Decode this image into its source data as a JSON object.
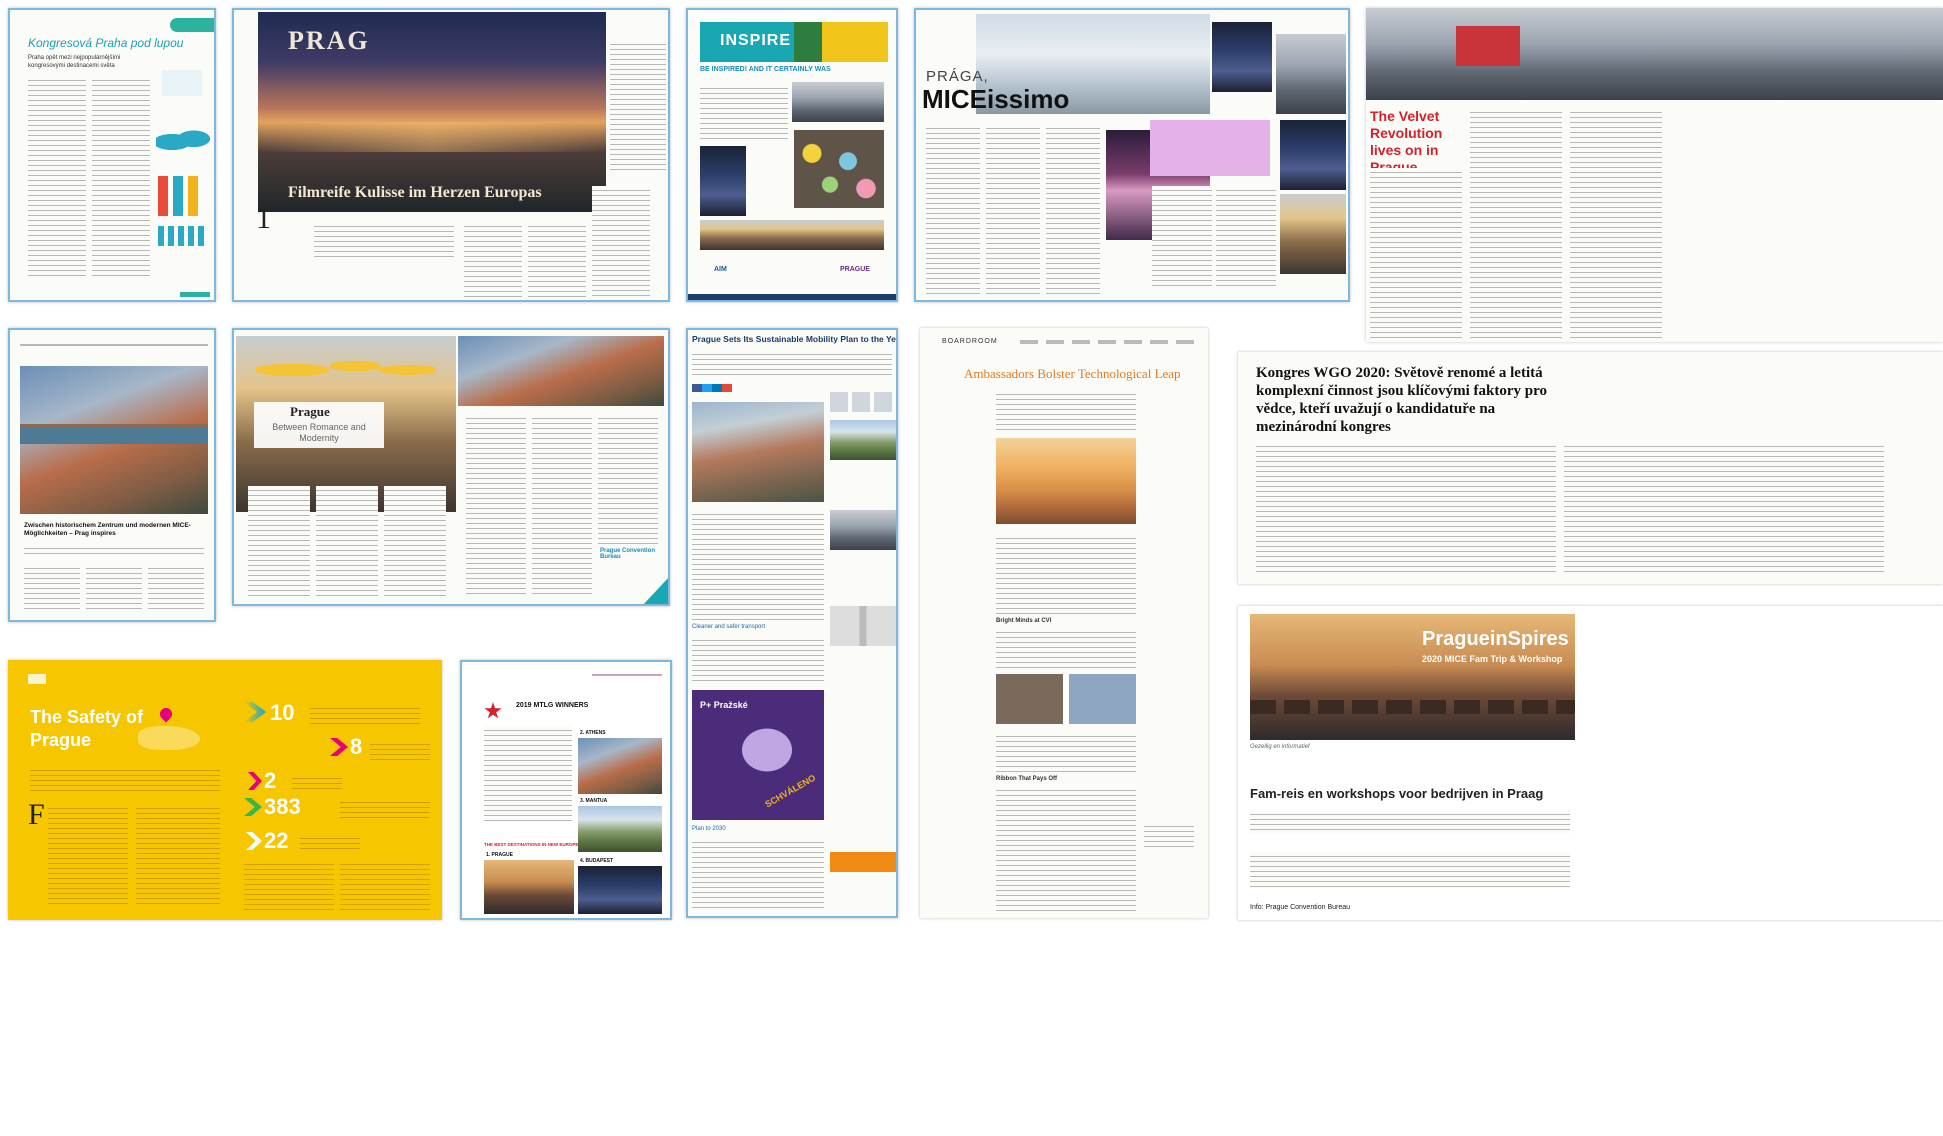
{
  "colors": {
    "frame_blue": "#7fb8de",
    "cover_teal": "#19a7b3",
    "velvet_red": "#d6202a",
    "safety_yellow": "#f6c600",
    "safety_magenta": "#e6007e",
    "safety_cyan": "#12a7d9",
    "wgo_text": "#111111",
    "mice_purple": "#8e3aa0",
    "fam_orange": "#f08a12"
  },
  "p1": {
    "title": "Kongresová Praha pod lupou",
    "subtitle": "Praha opět mezi nejpopulárnějšími kongresovými destinacemi světa"
  },
  "p2": {
    "masthead": "PRAG",
    "headline": "Filmreife Kulisse im  Herzen Europas",
    "chapter": "1"
  },
  "p3": {
    "banner": "INSPIRE",
    "headline": "BE INSPIRED! AND IT CERTAINLY WAS",
    "logo_aim": "AIM",
    "logo_prague": "PRAGUE"
  },
  "p4": {
    "kicker": "PRÁGA,",
    "title": "MICEissimo"
  },
  "p5": {
    "headline": "The Velvet Revolution lives on in Prague"
  },
  "p6": {
    "headline": "Zwischen historischem Zentrum und modernen MICE-Möglichkeiten – Prag inspires"
  },
  "p7": {
    "title": "Prague",
    "subtitle": "Between Romance and Modernity",
    "logo": "Prague Convention Bureau"
  },
  "p8": {
    "headline": "Prague Sets Its Sustainable Mobility Plan to the Year 2030",
    "subhead_1": "Cleaner and safer transport",
    "subhead_2": "Plan to 2030",
    "badge": "P+ Pražské",
    "stamp": "SCHVÁLENO"
  },
  "p9": {
    "brand": "BOARDROOM",
    "headline": "Ambassadors Bolster Technological Leap",
    "subhead_1": "Bright Minds at CVI",
    "subhead_2": "Ribbon That Pays Off"
  },
  "p10": {
    "headline": "Kongres WGO 2020: Světově renomé a letitá komplexní činnost jsou klíčovými faktory pro vědce, kteří uvažují o kandidatuře na mezinárodní kongres"
  },
  "p11": {
    "title": "The Safety of Prague",
    "stats": [
      {
        "value": "10"
      },
      {
        "value": "8"
      },
      {
        "value": "2"
      },
      {
        "value": "383"
      },
      {
        "value": "22"
      }
    ]
  },
  "p12": {
    "headline": "2019 MTLG WINNERS",
    "labels": [
      "2. ATHENS",
      "3. MANTUA",
      "1. PRAGUE",
      "4. BUDAPEST"
    ],
    "badge": "THE BEST DESTINATIONS IN NEW EUROPE"
  },
  "p13": {
    "brand": "PragueinSpires",
    "sub": "2020 MICE Fam Trip & Workshop",
    "caption": "Gezellig en informatief",
    "headline": "Fam-reis en workshops voor bedrijven in Praag",
    "footer": "Info: Prague Convention Bureau"
  }
}
